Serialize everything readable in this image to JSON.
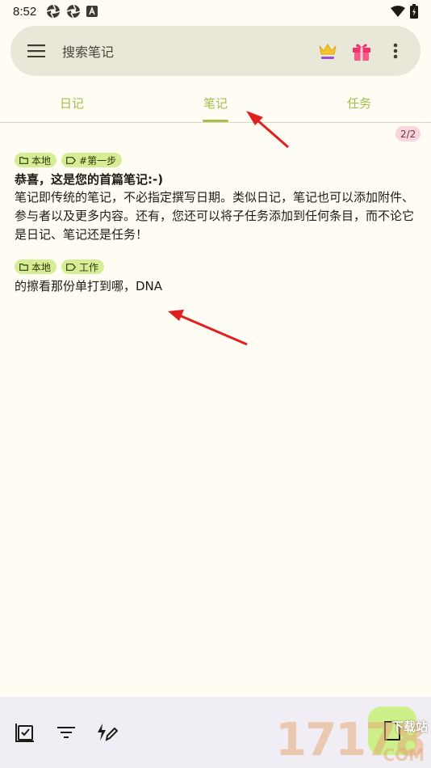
{
  "status_bar": {
    "time": "8:52",
    "left_icons": [
      "aperture-icon",
      "aperture-icon",
      "a-box-icon"
    ],
    "right_icons": [
      "wifi-icon",
      "battery-charging-icon"
    ]
  },
  "search": {
    "placeholder": "搜索笔记",
    "icons": [
      "menu-icon",
      "crown-icon",
      "gift-icon",
      "more-vert-icon"
    ]
  },
  "tabs": [
    {
      "label": "日记",
      "selected": false
    },
    {
      "label": "笔记",
      "selected": true
    },
    {
      "label": "任务",
      "selected": false
    }
  ],
  "count_badge": "2/2",
  "entries": [
    {
      "chips": [
        {
          "icon": "folder-icon",
          "label": "本地"
        },
        {
          "icon": "tag-icon",
          "label": "#第一步"
        }
      ],
      "title": "恭喜，这是您的首篇笔记:-)",
      "body": "笔记即传统的笔记，不必指定撰写日期。类似日记，笔记也可以添加附件、参与者以及更多内容。还有，您还可以将子任务添加到任何条目，而不论它是日记、笔记还是任务！"
    },
    {
      "chips": [
        {
          "icon": "folder-icon",
          "label": "本地"
        },
        {
          "icon": "tag-icon",
          "label": "工作"
        }
      ],
      "title": "",
      "body": "的擦看那份单打到哪，DNA"
    }
  ],
  "bottom_bar": {
    "icons": [
      "checklist-icon",
      "filter-icon",
      "quick-edit-icon"
    ],
    "fab_icon": "add-note-icon"
  },
  "watermark": {
    "digits": "17178",
    "tag": "下载站",
    "domain": "COM"
  },
  "colors": {
    "background": "#fffcf3",
    "accent": "#a8c04a",
    "chip": "#d6ec95",
    "badge": "#f8d4dc",
    "search_bar": "#e9e7d7",
    "bottom_bar": "#f1edf4",
    "annotation_arrow": "#e02020"
  }
}
